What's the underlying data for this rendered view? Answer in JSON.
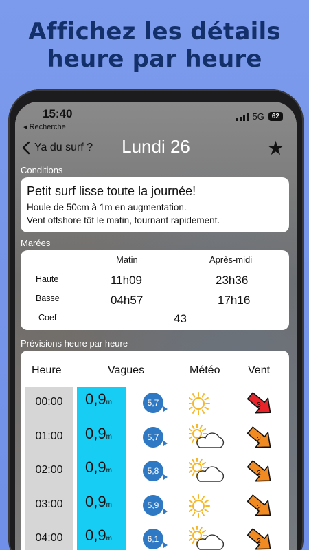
{
  "promo_title": [
    "Affichez les détails",
    "heure par heure"
  ],
  "status": {
    "time": "15:40",
    "back_app": "◂ Recherche",
    "network": "5G",
    "battery": "62"
  },
  "nav": {
    "back_label": "Ya du surf ?",
    "title": "Lundi 26"
  },
  "conditions": {
    "section_label": "Conditions",
    "headline": "Petit surf lisse toute la journée!",
    "details": [
      "Houle  de 50cm à 1m en augmentation.",
      "Vent offshore tôt le matin, tournant rapidement."
    ]
  },
  "tides": {
    "section_label": "Marées",
    "col_morning": "Matin",
    "col_afternoon": "Après-midi",
    "rows": [
      {
        "label": "Haute",
        "morning": "11h09",
        "afternoon": "23h36"
      },
      {
        "label": "Basse",
        "morning": "04h57",
        "afternoon": "17h16"
      }
    ],
    "coef_label": "Coef",
    "coef_value": "43"
  },
  "forecast": {
    "section_label": "Prévisions heure par heure",
    "headers": {
      "hour": "Heure",
      "waves": "Vagues",
      "weather": "Météo",
      "wind": "Vent"
    },
    "wave_unit": "m",
    "rows": [
      {
        "hour": "00:00",
        "wave": "0,9",
        "period": "5,7",
        "weather": "sun",
        "wind_force": "3",
        "wind_color": "#e8232a",
        "wind_rotation": 40
      },
      {
        "hour": "01:00",
        "wave": "0,9",
        "period": "5,7",
        "weather": "sun-cloud",
        "wind_force": "2",
        "wind_color": "#f28a22",
        "wind_rotation": 40
      },
      {
        "hour": "02:00",
        "wave": "0,9",
        "period": "5,8",
        "weather": "sun-cloud",
        "wind_force": "2",
        "wind_color": "#f28a22",
        "wind_rotation": 40
      },
      {
        "hour": "03:00",
        "wave": "0,9",
        "period": "5,9",
        "weather": "sun",
        "wind_force": "2",
        "wind_color": "#f28a22",
        "wind_rotation": 40
      },
      {
        "hour": "04:00",
        "wave": "0,9",
        "period": "6,1",
        "weather": "sun-cloud",
        "wind_force": "2",
        "wind_color": "#f28a22",
        "wind_rotation": 40
      }
    ]
  },
  "colors": {
    "period_badge": "#2f78c4",
    "wave_column": "#17cdf3",
    "promo_text": "#14306a"
  }
}
